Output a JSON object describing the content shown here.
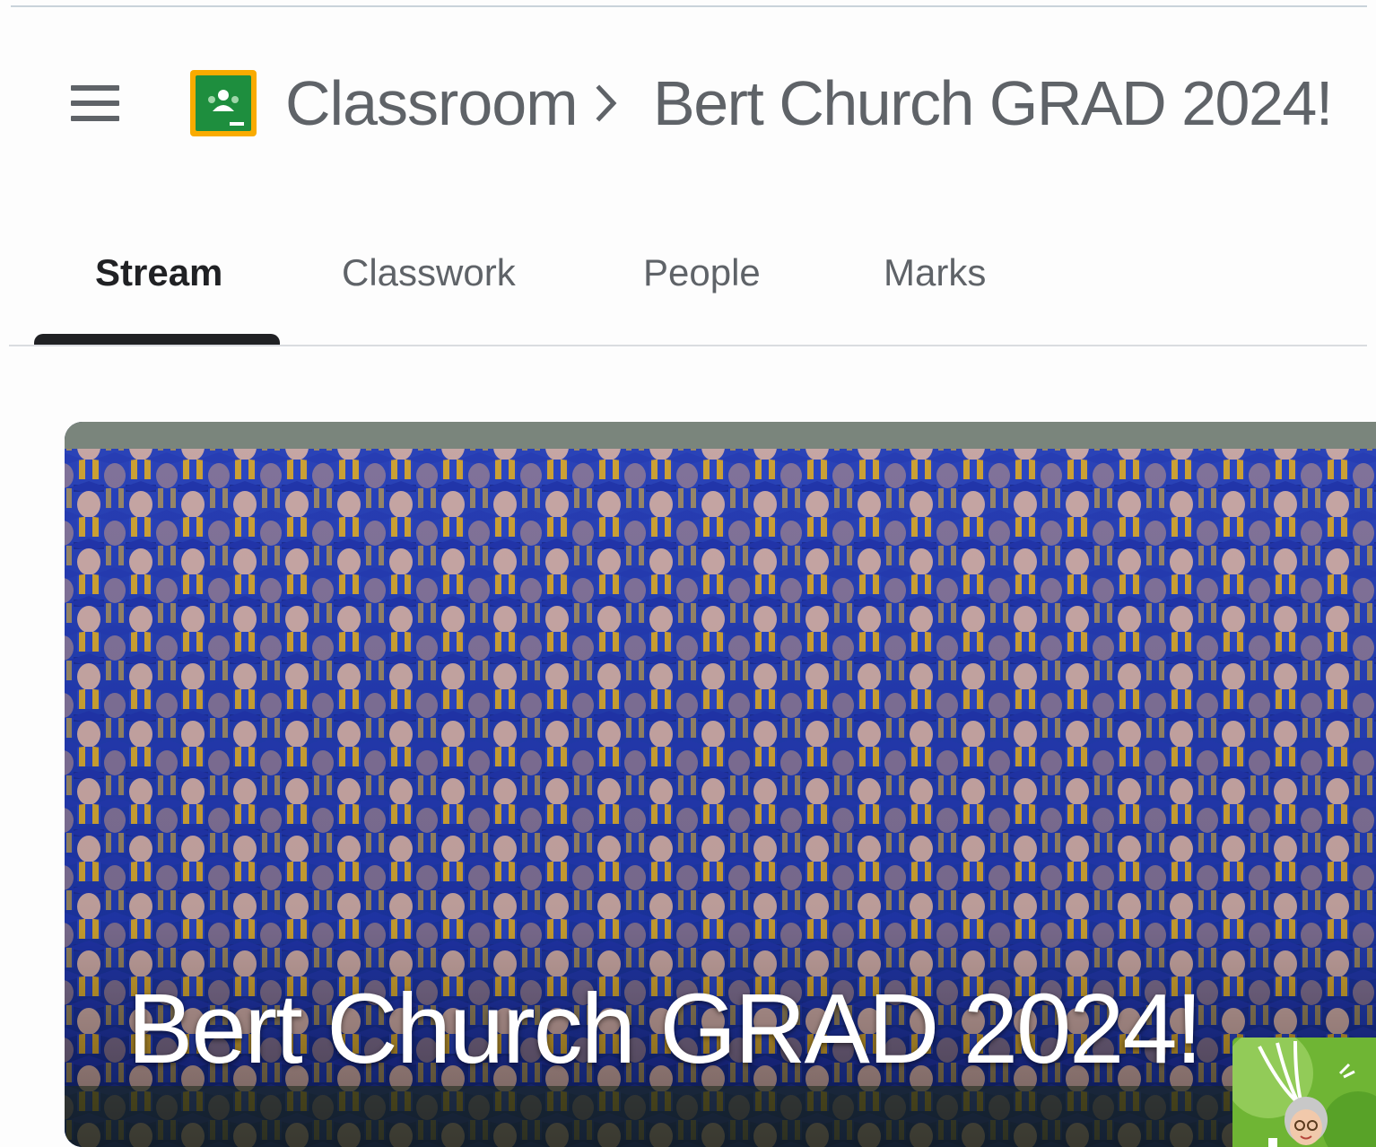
{
  "header": {
    "menu_icon": "hamburger-menu-icon",
    "logo_icon": "google-classroom-logo-icon",
    "brand": "Classroom",
    "separator_icon": "chevron-right-icon",
    "course_title": "Bert Church GRAD 2024!"
  },
  "tabs": [
    {
      "label": "Stream",
      "active": true
    },
    {
      "label": "Classwork",
      "active": false
    },
    {
      "label": "People",
      "active": false
    },
    {
      "label": "Marks",
      "active": false
    }
  ],
  "banner": {
    "title": "Bert Church GRAD 2024!"
  },
  "colors": {
    "gown_blue": "#1f3fb5",
    "stole_gold": "#e8b21e",
    "logo_green": "#1e8e3e",
    "logo_yellow": "#f9ab00",
    "tab_indicator": "#202124"
  }
}
